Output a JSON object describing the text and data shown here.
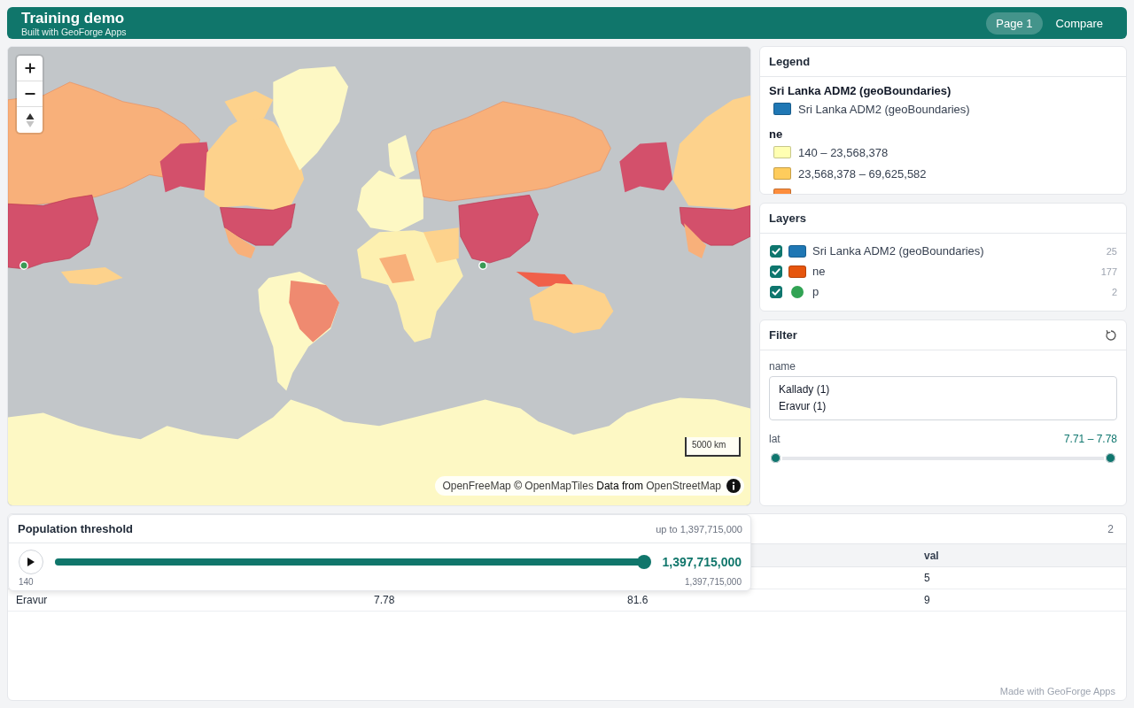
{
  "header": {
    "title": "Training demo",
    "subtitle": "Built with GeoForge Apps",
    "tabs": [
      {
        "label": "Page 1",
        "selected": true
      },
      {
        "label": "Compare",
        "selected": false
      }
    ]
  },
  "map": {
    "scale_label": "5000 km",
    "attribution": [
      {
        "text": "OpenFreeMap",
        "kind": "link"
      },
      {
        "text": "©",
        "kind": "text"
      },
      {
        "text": "OpenMapTiles",
        "kind": "link"
      },
      {
        "text": "Data from",
        "kind": "text"
      },
      {
        "text": "OpenStreetMap",
        "kind": "link"
      }
    ]
  },
  "legend": {
    "title": "Legend",
    "groups": [
      {
        "title": "Sri Lanka ADM2 (geoBoundaries)",
        "items": [
          {
            "label": "Sri Lanka ADM2 (geoBoundaries)",
            "color": "#1f77b4"
          }
        ]
      },
      {
        "title": "ne",
        "items": [
          {
            "label": "140 – 23,568,378",
            "color": "#ffffb2"
          },
          {
            "label": "23,568,378 – 69,625,582",
            "color": "#fecc5c"
          },
          {
            "color": "#fd8d3c"
          }
        ]
      }
    ]
  },
  "layers": {
    "title": "Layers",
    "items": [
      {
        "name": "Sri Lanka ADM2 (geoBoundaries)",
        "count": "25",
        "checked": true,
        "kind": "polygon",
        "color": "#1f77b4"
      },
      {
        "name": "ne",
        "count": "177",
        "checked": true,
        "kind": "polygon",
        "color": "#e6550d"
      },
      {
        "name": "p",
        "count": "2",
        "checked": true,
        "kind": "point",
        "color": "#31a354"
      }
    ]
  },
  "filter": {
    "title": "Filter",
    "fields": [
      {
        "kind": "list",
        "label": "name",
        "options": [
          "Kallady (1)",
          "Eravur (1)"
        ]
      },
      {
        "kind": "range",
        "label": "lat",
        "reading": "7.71 – 7.78",
        "thumbs": [
          {
            "level": 0
          },
          {
            "level": 1
          }
        ]
      }
    ]
  },
  "threshold": {
    "title": "Population threshold",
    "caption": "up to 1,397,715,000",
    "level": 1,
    "reading": "1,397,715,000",
    "min_label": "140",
    "max_label": "1,397,715,000"
  },
  "table": {
    "count": "2",
    "headings": {
      "column_4": "val"
    },
    "rows": [
      {
        "column_4": "5"
      },
      {
        "column_1": "Eravur",
        "column_2": "7.78",
        "column_3": "81.6",
        "column_4": "9"
      }
    ]
  },
  "footer": "Made with GeoForge Apps"
}
